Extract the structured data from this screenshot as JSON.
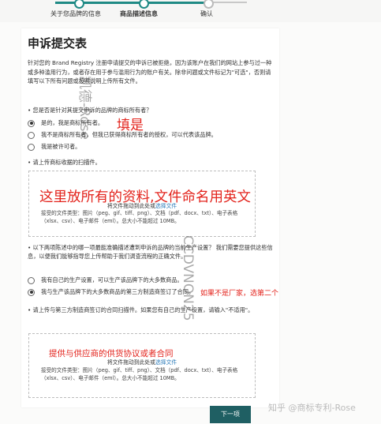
{
  "stepper": {
    "steps": [
      "关于您品牌的信息",
      "商品描述信息",
      "确认"
    ]
  },
  "form": {
    "title": "申诉提交表",
    "intro": "针对您的 Brand Registry 注册申请提交的申诉已被拒绝，因为该账户在我们的网站上参与过一种或多种滥用行为，或者存在用于参与滥用行为的账户有关。除非问题或文件标记为\"可选\"，否则请填写以下所有问题或按照说明上传所有文件。",
    "q1": "• 您是否是针对其提交申诉的品牌的商标所有者？",
    "q1_options": [
      "是的，我是商标所有者。",
      "我不是商标所有者，但我已获得商标所有者的授权，可以代表该品牌。",
      "我是被许可者。"
    ],
    "q2": "• 请上传商标收据的扫描件。",
    "upload1": {
      "drop_prefix": "将文件拖动到此处或",
      "drop_link": "选择文件",
      "accept": "接受的文件类型：图片（peg、gif、tiff、png）、文档（pdf、docx、txt）、电子表格（xlsx、csv）、电子邮件（eml）。总大小不能超过 10MB。"
    },
    "q3": "• 以下两项陈述中的哪一项最能准确描述遭到申诉的品牌的当前生产设置？ 我们需要您提供这些信息，以便我们能够指导您上传帮助于我们调查流程的正确文件。",
    "q3_options": [
      "我有自己的生产设置，可以生产该品牌下的大多数商品。",
      "我与生产该品牌下的大多数商品的第三方制造商签订了合同。"
    ],
    "q4": "• 请上传与第三方制造商签订的合同扫描件。如果您有自己的生产设置，请输入\"不适用\"。",
    "upload2": {
      "drop_prefix": "将文件拖动到此处或",
      "drop_link": "选择文件",
      "accept": "接受的文件类型：图片（peg、gif、tiff、png）、文档（pdf、docx、txt）、电子表格（xlsx、csv）、电子邮件（eml）。总大小不能超过 10MB。"
    },
    "next_label": "下一项"
  },
  "annotations": {
    "fill_yes": "填是",
    "upload_note": "这里放所有的资料,文件命名用英文",
    "not_factory": "如果不是厂家，选第二个",
    "supplier_note": "提供与供应商的供货协议或者合同"
  },
  "watermarks": {
    "name": "凯德-Rose",
    "id": "CCDVNON25",
    "zhihu": "知乎 @商标专利-Rose"
  },
  "colors": {
    "accent": "#1f8a85",
    "button": "#1f5f63",
    "annotation": "#e3241d",
    "link": "#2b7bb9"
  }
}
